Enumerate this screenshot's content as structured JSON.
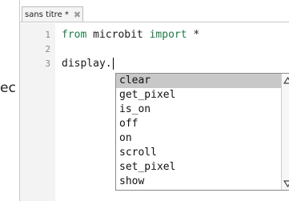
{
  "side_fragment": "ec",
  "tab": {
    "title": "sans titre *",
    "close_icon": "close-icon"
  },
  "editor": {
    "line_numbers": [
      "1",
      "2",
      "3"
    ],
    "lines": [
      {
        "kw1": "from",
        "mid": " microbit ",
        "kw2": "import",
        "tail": " *"
      },
      {
        "text": ""
      },
      {
        "text": "display."
      }
    ]
  },
  "autocomplete": {
    "items": [
      "clear",
      "get_pixel",
      "is_on",
      "off",
      "on",
      "scroll",
      "set_pixel",
      "show"
    ],
    "selected_index": 0,
    "scroll_up_icon": "scroll-up-triangle-icon",
    "scroll_down_icon": "scroll-down-triangle-icon"
  },
  "colors": {
    "keyword": "#1e7b46",
    "selection": "#c8c8c8",
    "gutter": "#f3f3f3"
  }
}
